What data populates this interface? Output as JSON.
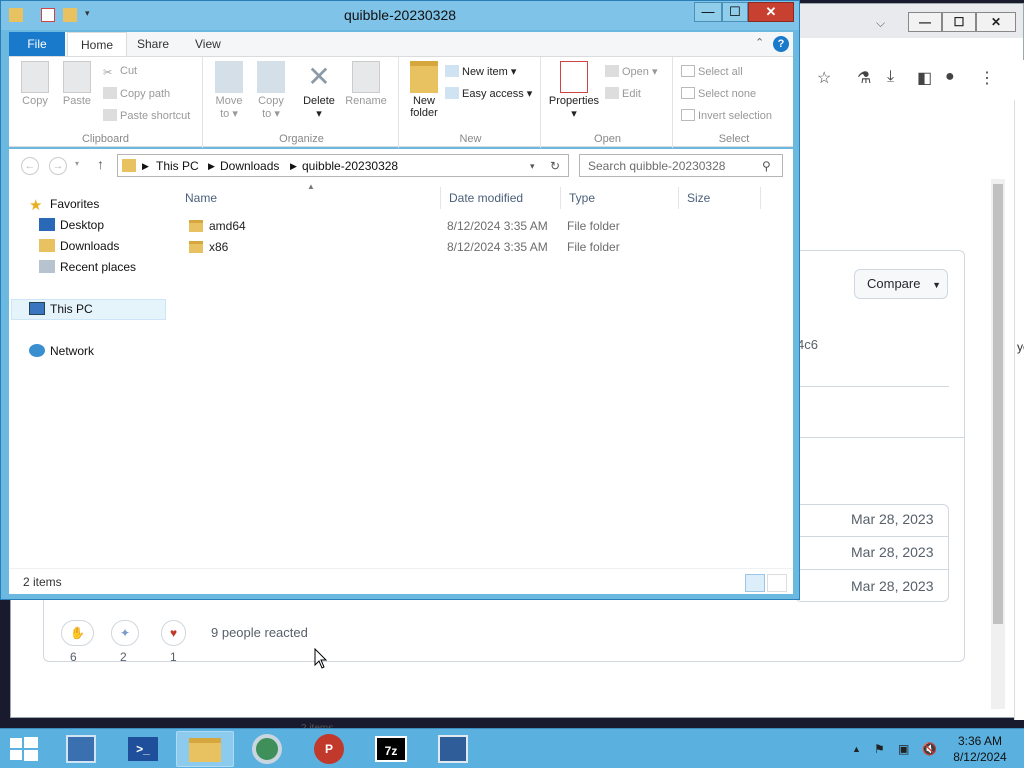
{
  "browser": {
    "compare_label": "Compare",
    "hash_fragment": "4c6",
    "dates": [
      "Mar 28, 2023",
      "Mar 28, 2023",
      "Mar 28, 2023"
    ],
    "reactions": [
      {
        "count": "6"
      },
      {
        "count": "2"
      },
      {
        "count": "1"
      }
    ],
    "reacted_text": "9 people reacted",
    "bottom_text": "2 items",
    "side_cut_text": "yo"
  },
  "explorer": {
    "title": "quibble-20230328",
    "tabs": {
      "file": "File",
      "home": "Home",
      "share": "Share",
      "view": "View"
    },
    "ribbon": {
      "clipboard": {
        "label": "Clipboard",
        "copy": "Copy",
        "paste": "Paste",
        "cut": "Cut",
        "copy_path": "Copy path",
        "paste_shortcut": "Paste shortcut"
      },
      "organize": {
        "label": "Organize",
        "move_to": "Move",
        "move_to2": "to",
        "copy_to": "Copy",
        "copy_to2": "to",
        "delete": "Delete",
        "rename": "Rename"
      },
      "new": {
        "label": "New",
        "new_folder": "New",
        "new_folder2": "folder",
        "new_item": "New item",
        "easy_access": "Easy access"
      },
      "open": {
        "label": "Open",
        "properties": "Properties",
        "open": "Open",
        "edit": "Edit"
      },
      "select": {
        "label": "Select",
        "select_all": "Select all",
        "select_none": "Select none",
        "invert": "Invert selection"
      }
    },
    "address": {
      "parts": [
        "This PC",
        "Downloads",
        "quibble-20230328"
      ]
    },
    "search_placeholder": "Search quibble-20230328",
    "nav": {
      "favorites": "Favorites",
      "desktop": "Desktop",
      "downloads": "Downloads",
      "recent": "Recent places",
      "this_pc": "This PC",
      "network": "Network"
    },
    "columns": {
      "name": "Name",
      "date": "Date modified",
      "type": "Type",
      "size": "Size"
    },
    "files": [
      {
        "name": "amd64",
        "date": "8/12/2024 3:35 AM",
        "type": "File folder"
      },
      {
        "name": "x86",
        "date": "8/12/2024 3:35 AM",
        "type": "File folder"
      }
    ],
    "status": "2 items"
  },
  "taskbar": {
    "time": "3:36 AM",
    "date": "8/12/2024"
  },
  "colors": {
    "accent": "#1979ca",
    "taskbar": "#5ab0df",
    "title": "#7fc4e8"
  }
}
